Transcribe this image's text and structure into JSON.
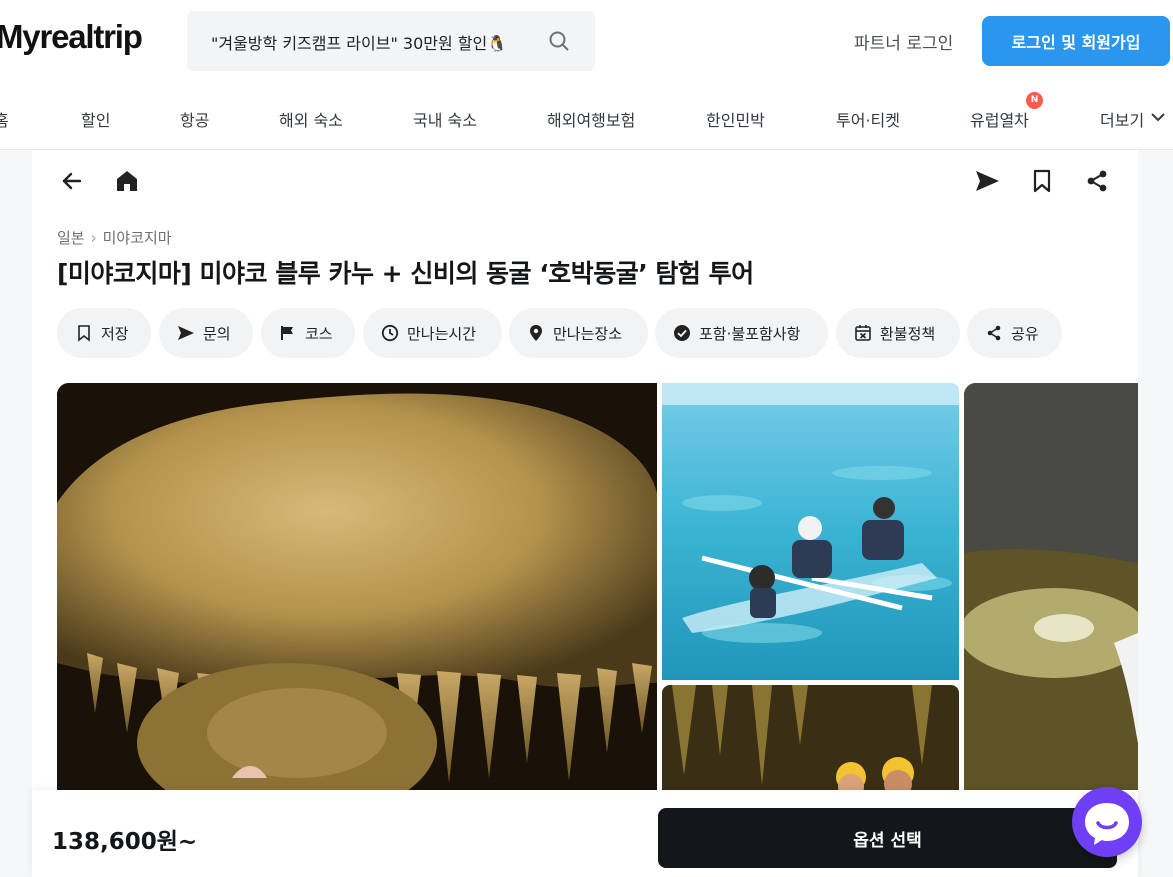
{
  "header": {
    "logo": "Myrealtrip",
    "search_text": "\"겨울방학 키즈캠프 라이브\" 30만원 할인🐧",
    "partner_login": "파트너 로그인",
    "login_signup": "로그인 및 회원가입"
  },
  "nav": {
    "items": [
      "홈",
      "할인",
      "항공",
      "해외 숙소",
      "국내 숙소",
      "해외여행보험",
      "한인민박",
      "투어·티켓",
      "유럽열차",
      "더보기"
    ],
    "new_badge": "N"
  },
  "product": {
    "breadcrumb": [
      "일본",
      "미야코지마"
    ],
    "title": "[미야코지마] 미야코 블루 카누 + 신비의 동굴 ‘호박동굴’ 탐험 투어",
    "chips": [
      {
        "label": "저장",
        "icon": "bookmark-icon"
      },
      {
        "label": "문의",
        "icon": "send-icon"
      },
      {
        "label": "코스",
        "icon": "flag-icon"
      },
      {
        "label": "만나는시간",
        "icon": "clock-icon"
      },
      {
        "label": "만나는장소",
        "icon": "location-pin-icon"
      },
      {
        "label": "포함·불포함사항",
        "icon": "check-circle-icon"
      },
      {
        "label": "환불정책",
        "icon": "calendar-x-icon"
      },
      {
        "label": "공유",
        "icon": "share-icon"
      }
    ]
  },
  "bottom_bar": {
    "price": "138,600원~",
    "option_button": "옵션 선택"
  },
  "colors": {
    "primary_blue": "#2b96ed",
    "dark": "#141719",
    "chat_purple": "#6f3ff5",
    "badge_red": "#ff5a4e"
  }
}
